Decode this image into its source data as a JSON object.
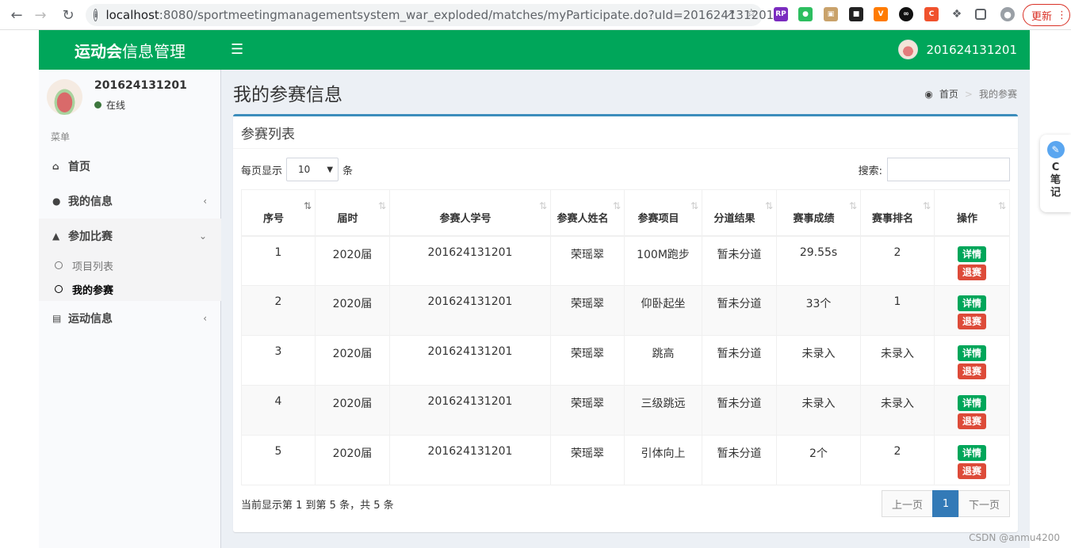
{
  "browser": {
    "url_host": "localhost",
    "url_path": ":8080/sportmeetingmanagementsystem_war_exploded/matches/myParticipate.do?uId=201624131201",
    "update_label": "更新"
  },
  "header": {
    "logo_bold": "运动会",
    "logo_rest": "信息管理",
    "toggle_icon": "☰",
    "username": "201624131201"
  },
  "sidebar": {
    "username": "201624131201",
    "status": "在线",
    "menu_header": "菜单",
    "items": [
      {
        "label": "首页",
        "icon": "home-icon"
      },
      {
        "label": "我的信息",
        "icon": "user-icon"
      },
      {
        "label": "参加比赛",
        "icon": "trophy-icon"
      },
      {
        "label": "运动信息",
        "icon": "chart-icon"
      }
    ],
    "subitems": [
      {
        "label": "项目列表"
      },
      {
        "label": "我的参赛"
      }
    ]
  },
  "content": {
    "title": "我的参赛信息",
    "breadcrumb_home": "首页",
    "breadcrumb_current": "我的参赛",
    "box_title": "参赛列表",
    "length_prefix": "每页显示",
    "length_value": "10",
    "length_suffix": "条",
    "search_label": "搜索:",
    "columns": [
      "序号",
      "届时",
      "参赛人学号",
      "参赛人姓名",
      "参赛项目",
      "分道结果",
      "赛事成绩",
      "赛事排名",
      "操作"
    ],
    "rows": [
      {
        "no": "1",
        "session": "2020届",
        "sid": "201624131201",
        "name": "荣瑶翠",
        "event": "100M跑步",
        "lane": "暂未分道",
        "score": "29.55s",
        "rank": "2"
      },
      {
        "no": "2",
        "session": "2020届",
        "sid": "201624131201",
        "name": "荣瑶翠",
        "event": "仰卧起坐",
        "lane": "暂未分道",
        "score": "33个",
        "rank": "1"
      },
      {
        "no": "3",
        "session": "2020届",
        "sid": "201624131201",
        "name": "荣瑶翠",
        "event": "跳高",
        "lane": "暂未分道",
        "score": "未录入",
        "rank": "未录入"
      },
      {
        "no": "4",
        "session": "2020届",
        "sid": "201624131201",
        "name": "荣瑶翠",
        "event": "三级跳远",
        "lane": "暂未分道",
        "score": "未录入",
        "rank": "未录入"
      },
      {
        "no": "5",
        "session": "2020届",
        "sid": "201624131201",
        "name": "荣瑶翠",
        "event": "引体向上",
        "lane": "暂未分道",
        "score": "2个",
        "rank": "2"
      }
    ],
    "detail_label": "详情",
    "quit_label": "退赛",
    "info_text": "当前显示第 1 到第 5 条，共 5 条",
    "prev_label": "上一页",
    "page_current": "1",
    "next_label": "下一页"
  },
  "widget": {
    "letter": "C",
    "text": "笔记"
  },
  "watermark": "CSDN @anmu4200",
  "colors": {
    "header": "#00a65a",
    "box_border": "#3c8dbc",
    "detail": "#00a65a",
    "quit": "#dd4b39"
  }
}
